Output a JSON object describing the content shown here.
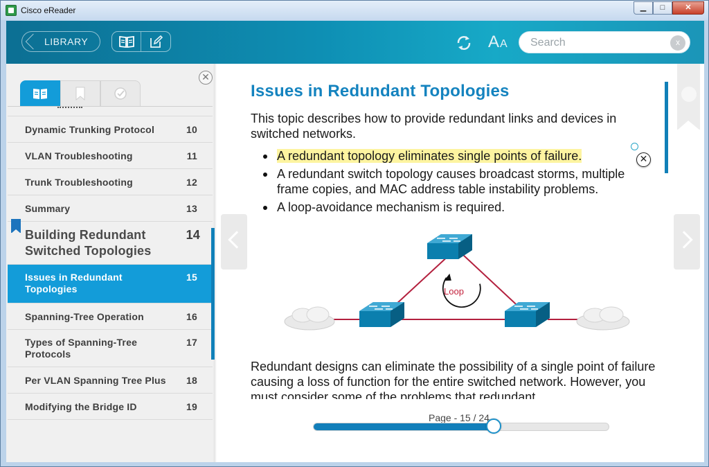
{
  "window": {
    "title": "Cisco eReader",
    "controls": {
      "minimize": "▁",
      "maximize": "□",
      "close": "✕"
    }
  },
  "header": {
    "library_label": "LIBRARY",
    "search_placeholder": "Search",
    "search_clear": "x",
    "font_big": "A",
    "font_small": "A"
  },
  "sidebar": {
    "close_glyph": "✕",
    "toc": [
      {
        "label": "Dynamic Trunking Protocol",
        "page": "10"
      },
      {
        "label": "VLAN Troubleshooting",
        "page": "11"
      },
      {
        "label": "Trunk Troubleshooting",
        "page": "12"
      },
      {
        "label": "Summary",
        "page": "13"
      },
      {
        "label": "Building Redundant Switched Topologies",
        "page": "14"
      },
      {
        "label": "Issues in Redundant Topologies",
        "page": "15"
      },
      {
        "label": "Spanning-Tree Operation",
        "page": "16"
      },
      {
        "label": "Types of Spanning-Tree Protocols",
        "page": "17"
      },
      {
        "label": "Per VLAN Spanning Tree Plus",
        "page": "18"
      },
      {
        "label": "Modifying the Bridge ID",
        "page": "19"
      }
    ]
  },
  "article": {
    "title": "Issues in Redundant Topologies",
    "intro": "This topic describes how to provide redundant links and devices in switched networks.",
    "bullets": [
      "A redundant topology eliminates single points of failure.",
      "A redundant switch topology causes broadcast storms, multiple frame copies, and MAC address table instability problems.",
      "A loop-avoidance mechanism is required."
    ],
    "note_close": "✕",
    "diagram_label": "Loop",
    "paragraph": "Redundant designs can eliminate the possibility of a single point of failure causing a loss of function for the entire switched network. However, you must consider some of the problems that redundant"
  },
  "pager": {
    "label": "Page - 15 / 24",
    "current": 15,
    "total": 24,
    "progress": 0.61
  },
  "colors": {
    "accent": "#139cd9",
    "title_blue": "#1483bf",
    "highlight": "#fdf4a0",
    "link_red": "#c21f3a"
  }
}
